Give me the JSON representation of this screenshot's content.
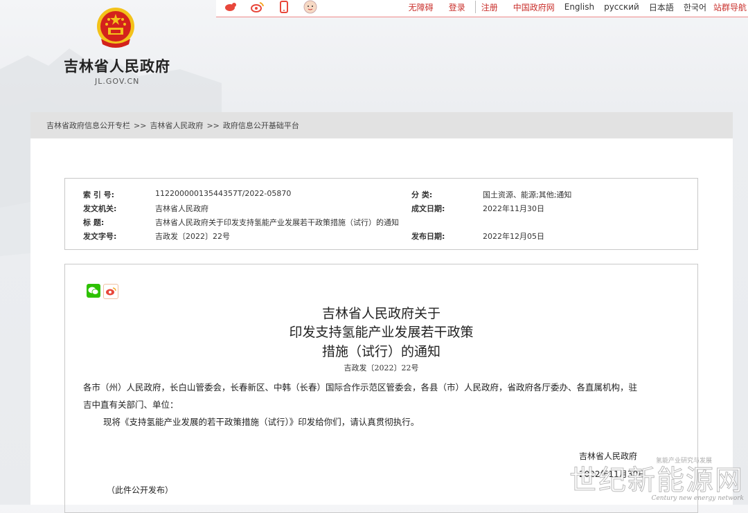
{
  "topbar": {
    "icons": [
      "weibo-icon",
      "weibo-circle-icon",
      "mobile-icon",
      "avatar-icon"
    ],
    "accessibility": "无障碍",
    "login": "登录",
    "register": "注册",
    "gov_cn": "中国政府网",
    "english": "English",
    "russian": "русский",
    "japanese": "日本語",
    "korean": "한국어",
    "site_nav": "站群导航"
  },
  "logo": {
    "title": "吉林省人民政府",
    "domain": "JL.GOV.CN"
  },
  "breadcrumb": {
    "items": [
      "吉林省政府信息公开专栏",
      "吉林省人民政府",
      "政府信息公开基础平台"
    ],
    "separator": ">>"
  },
  "info": {
    "index_label": "索 引 号:",
    "index_value": "11220000013544357T/2022-05870",
    "category_label": "分    类:",
    "category_value": "国土资源、能源;其他;通知",
    "issuer_label": "发文机关:",
    "issuer_value": "吉林省人民政府",
    "created_label": "成文日期:",
    "created_value": "2022年11月30日",
    "title_label": "标    题:",
    "title_value": "吉林省人民政府关于印发支持氢能产业发展若干政策措施（试行）的通知",
    "docno_label": "发文字号:",
    "docno_value": "吉政发〔2022〕22号",
    "published_label": "发布日期:",
    "published_value": "2022年12月05日"
  },
  "doc": {
    "title_line1": "吉林省人民政府关于",
    "title_line2": "印发支持氢能产业发展若干政策",
    "title_line3": "措施（试行）的通知",
    "number": "吉政发〔2022〕22号",
    "para1_line1": "各市（州）人民政府，长白山管委会，长春新区、中韩（长春）国际合作示范区管委会，各县（市）人民政府，省政府各厅委办、各直属机构，驻",
    "para1_line2": "吉中直有关部门、单位：",
    "para2": "现将《支持氢能产业发展的若干政策措施（试行）》印发给你们，请认真贯彻执行。",
    "signer": "吉林省人民政府",
    "sign_date": "2022年11月30日",
    "note": "（此件公开发布）"
  },
  "watermark": {
    "small": "氢能产业研究与发展",
    "big": "世纪新能源网",
    "en": "Century new energy network"
  },
  "colors": {
    "accent_red": "#c9302c",
    "emblem_red": "#d3221c",
    "emblem_gold": "#f3c21a",
    "wechat_green": "#2dc100",
    "weibo_orange": "#f5a623"
  }
}
